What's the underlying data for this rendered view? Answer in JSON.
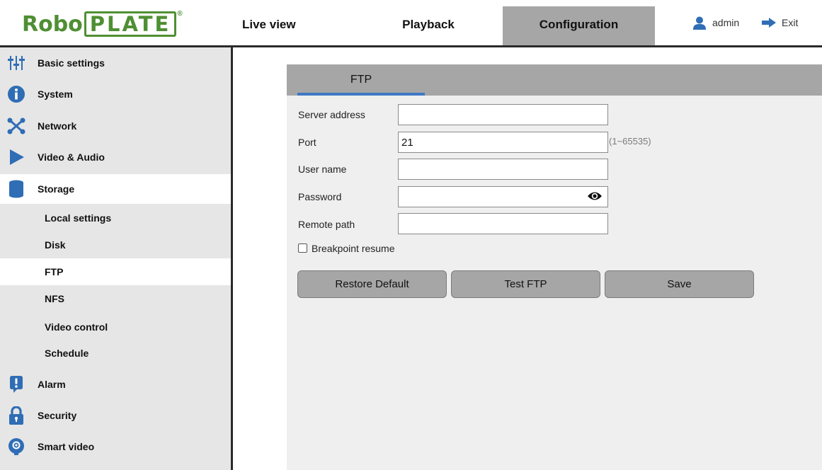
{
  "app": {
    "logo_word1": "Robo",
    "logo_word2": "PLATE",
    "logo_mark": "®"
  },
  "nav": {
    "live_view": "Live view",
    "playback": "Playback",
    "configuration": "Configuration",
    "user": "admin",
    "exit": "Exit"
  },
  "sidebar": {
    "items": [
      {
        "label": "Basic settings",
        "icon": "sliders-icon"
      },
      {
        "label": "System",
        "icon": "info-icon"
      },
      {
        "label": "Network",
        "icon": "network-icon"
      },
      {
        "label": "Video & Audio",
        "icon": "play-icon"
      },
      {
        "label": "Storage",
        "icon": "database-icon"
      },
      {
        "label": "Alarm",
        "icon": "alert-icon"
      },
      {
        "label": "Security",
        "icon": "lock-icon"
      },
      {
        "label": "Smart video",
        "icon": "smart-video-icon"
      }
    ],
    "storage_sub": [
      {
        "label": "Local settings"
      },
      {
        "label": "Disk"
      },
      {
        "label": "FTP"
      },
      {
        "label": "NFS"
      },
      {
        "label": "Video control"
      },
      {
        "label": "Schedule"
      }
    ]
  },
  "ftp": {
    "tab_label": "FTP",
    "server_address": {
      "label": "Server address",
      "value": ""
    },
    "port": {
      "label": "Port",
      "value": "21",
      "range": "(1~65535)"
    },
    "user_name": {
      "label": "User name",
      "value": ""
    },
    "password": {
      "label": "Password",
      "value": ""
    },
    "remote_path": {
      "label": "Remote path",
      "value": ""
    },
    "breakpoint_resume": {
      "label": "Breakpoint resume",
      "checked": false
    },
    "buttons": {
      "restore_default": "Restore Default",
      "test_ftp": "Test FTP",
      "save": "Save"
    }
  },
  "colors": {
    "brand_green": "#4f8f33",
    "accent_blue": "#3f79c4",
    "icon_blue": "#2f6db5",
    "tab_active_gray": "#a6a6a6"
  }
}
